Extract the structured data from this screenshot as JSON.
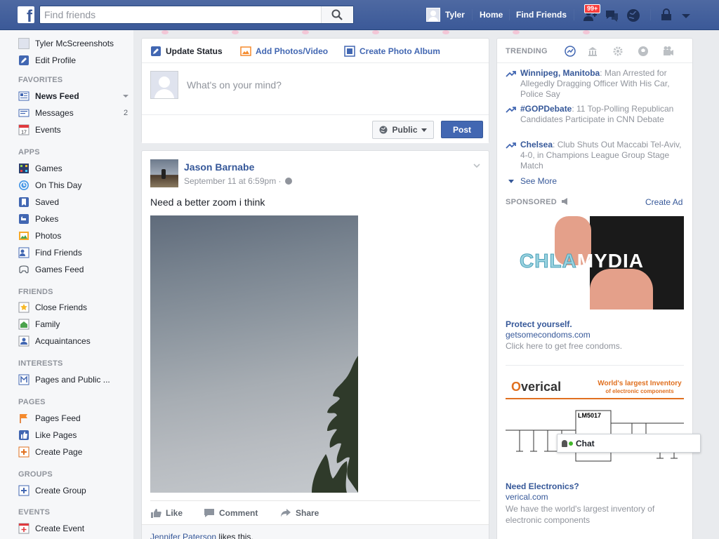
{
  "topbar": {
    "logo": "f",
    "search_placeholder": "Find friends",
    "user_name": "Tyler",
    "home_label": "Home",
    "find_friends_label": "Find Friends",
    "notification_count": "99+",
    "icons": [
      "friend-requests-icon",
      "messages-icon",
      "notifications-globe-icon",
      "privacy-lock-icon",
      "account-menu-caret-icon"
    ]
  },
  "sidebar": {
    "profile_name": "Tyler McScreenshots",
    "edit_profile": "Edit Profile",
    "favorites_heading": "FAVORITES",
    "favorites": [
      {
        "label": "News Feed",
        "icon": "news-feed-icon"
      },
      {
        "label": "Messages",
        "icon": "messages-icon",
        "count": "2"
      },
      {
        "label": "Events",
        "icon": "events-calendar-icon",
        "glyph": "17"
      }
    ],
    "apps_heading": "APPS",
    "apps": [
      {
        "label": "Games",
        "icon": "games-icon"
      },
      {
        "label": "On This Day",
        "icon": "on-this-day-icon"
      },
      {
        "label": "Saved",
        "icon": "saved-bookmark-icon"
      },
      {
        "label": "Pokes",
        "icon": "pokes-icon"
      },
      {
        "label": "Photos",
        "icon": "photos-icon"
      },
      {
        "label": "Find Friends",
        "icon": "find-friends-icon"
      },
      {
        "label": "Games Feed",
        "icon": "games-feed-icon"
      }
    ],
    "friends_heading": "FRIENDS",
    "friends": [
      {
        "label": "Close Friends",
        "icon": "close-friends-icon"
      },
      {
        "label": "Family",
        "icon": "family-icon"
      },
      {
        "label": "Acquaintances",
        "icon": "acquaintances-icon"
      }
    ],
    "interests_heading": "INTERESTS",
    "interests": [
      {
        "label": "Pages and Public ...",
        "icon": "pages-public-figures-icon"
      }
    ],
    "pages_heading": "PAGES",
    "pages": [
      {
        "label": "Pages Feed",
        "icon": "pages-feed-flag-icon"
      },
      {
        "label": "Like Pages",
        "icon": "like-pages-icon"
      },
      {
        "label": "Create Page",
        "icon": "create-page-icon"
      }
    ],
    "groups_heading": "GROUPS",
    "groups": [
      {
        "label": "Create Group",
        "icon": "create-group-icon"
      }
    ],
    "events_heading": "EVENTS",
    "events": [
      {
        "label": "Create Event",
        "icon": "create-event-icon"
      }
    ]
  },
  "composer": {
    "tabs": [
      {
        "label": "Update Status",
        "icon": "pencil-icon"
      },
      {
        "label": "Add Photos/Video",
        "icon": "photo-icon"
      },
      {
        "label": "Create Photo Album",
        "icon": "album-icon"
      }
    ],
    "placeholder": "What's on your mind?",
    "privacy_label": "Public",
    "post_label": "Post"
  },
  "post": {
    "author": "Jason Barnabe",
    "timestamp": "September 11 at 6:59pm · ",
    "text": "Need a better zoom i think",
    "actions": {
      "like": "Like",
      "comment": "Comment",
      "share": "Share"
    },
    "likes_name": "Jennifer Paterson",
    "likes_suffix": " likes this."
  },
  "trending": {
    "heading": "TRENDING",
    "items": [
      {
        "keyword": "Winnipeg, Manitoba",
        "text": ": Man Arrested for Allegedly Dragging Officer With His Car, Police Say"
      },
      {
        "keyword": "#GOPDebate",
        "text": ": 11 Top-Polling Republican Candidates Participate in CNN Debate"
      },
      {
        "keyword": "Chelsea",
        "text": ": Club Shuts Out Maccabi Tel-Aviv, 4-0, in Champions League Group Stage Match"
      }
    ],
    "see_more": "See More"
  },
  "sponsored": {
    "heading": "SPONSORED",
    "create_ad": "Create Ad",
    "ads": [
      {
        "image_text_a": "CHLA",
        "image_text_b": "MYDIA",
        "title": "Protect yourself.",
        "url": "getsomecondoms.com",
        "desc": "Click here to get free condoms."
      },
      {
        "logo_o": "O",
        "logo_rest": "verical",
        "tagline": "World's largest Inventory",
        "tagline_sub": "of electronic components",
        "chip_label": "LM5017",
        "title": "Need Electronics?",
        "url": "verical.com",
        "desc": "We have the world's largest inventory of electronic components"
      }
    ]
  },
  "chat": {
    "label": "Chat"
  }
}
